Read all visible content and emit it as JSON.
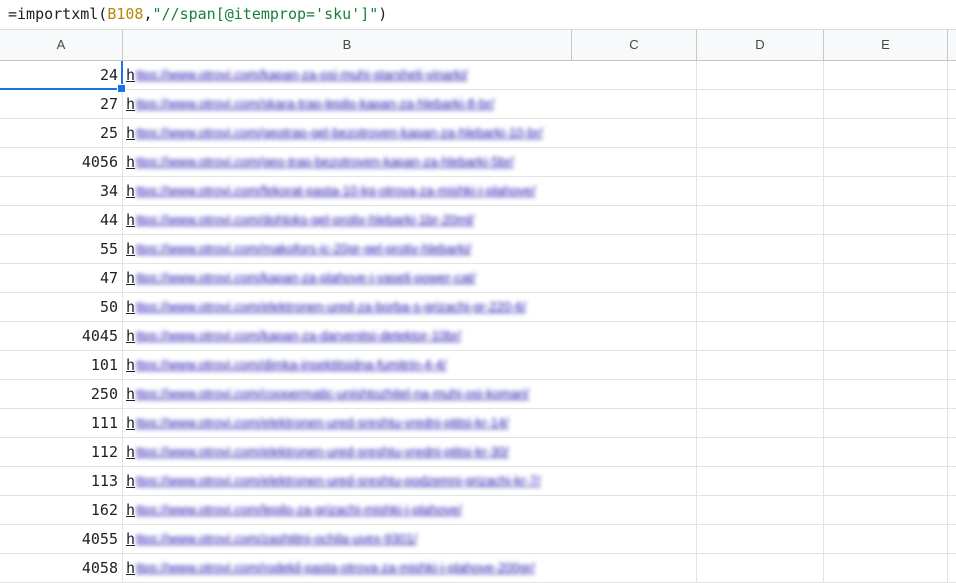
{
  "formula": {
    "prefix": "=importxml(",
    "ref": "B108",
    "sep": ",",
    "str": "\"//span[@itemprop='sku']\"",
    "suffix": ")"
  },
  "columns": [
    "A",
    "B",
    "C",
    "D",
    "E"
  ],
  "rows": [
    {
      "a": "24",
      "link": "https://www.otrovi.com/kapan-za-osi-muhi-starsheli-vinarki/"
    },
    {
      "a": "27",
      "link": "https://www.otrovi.com/skara-trap-lepilo-kapan-za-hlebarki-8-br/"
    },
    {
      "a": "25",
      "link": "https://www.otrovi.com/geotrap-gel-bezotroven-kapan-za-hlebarki-10-br/"
    },
    {
      "a": "4056",
      "link": "https://www.otrovi.com/geo-trap-bezotroven-kapan-za-hlebarki-5br/"
    },
    {
      "a": "34",
      "link": "https://www.otrovi.com/fekorat-pasta-10-kg-otrova-za-mishki-i-plahove/"
    },
    {
      "a": "44",
      "link": "https://www.otrovi.com/dohloks-gel-protiv-hlebarki-1br-20ml/"
    },
    {
      "a": "55",
      "link": "https://www.otrovi.com/makofors-ic-20gr-gel-protiv-hlebarki/"
    },
    {
      "a": "47",
      "link": "https://www.otrovi.com/kapan-za-plahove-i-vaseli-power-cat/"
    },
    {
      "a": "50",
      "link": "https://www.otrovi.com/elektronen-ured-za-borba-s-grizachi-gr-220-6/"
    },
    {
      "a": "4045",
      "link": "https://www.otrovi.com/kapan-za-darvenitsi-detektor-10br/"
    },
    {
      "a": "101",
      "link": "https://www.otrovi.com/dimka-insektitsidna-fumitrin-4-4/"
    },
    {
      "a": "250",
      "link": "https://www.otrovi.com/coopermatic-unishtozhitel-na-muhi-osi-komari/"
    },
    {
      "a": "111",
      "link": "https://www.otrovi.com/elektronen-ured-sreshtu-vredni-ptitsi-kr-14/"
    },
    {
      "a": "112",
      "link": "https://www.otrovi.com/elektronen-ured-sreshtu-vredni-ptitsi-kr-30/"
    },
    {
      "a": "113",
      "link": "https://www.otrovi.com/elektronen-ured-sreshtu-podzemni-grizachi-kr-7/"
    },
    {
      "a": "162",
      "link": "https://www.otrovi.com/lepilo-za-grizachi-mishki-i-plahove/"
    },
    {
      "a": "4055",
      "link": "https://www.otrovi.com/zashtitni-ochila-uvex-9301/"
    },
    {
      "a": "4058",
      "link": "https://www.otrovi.com/rodekil-pasta-otrova-za-mishki-i-plahove-200gr/"
    }
  ]
}
